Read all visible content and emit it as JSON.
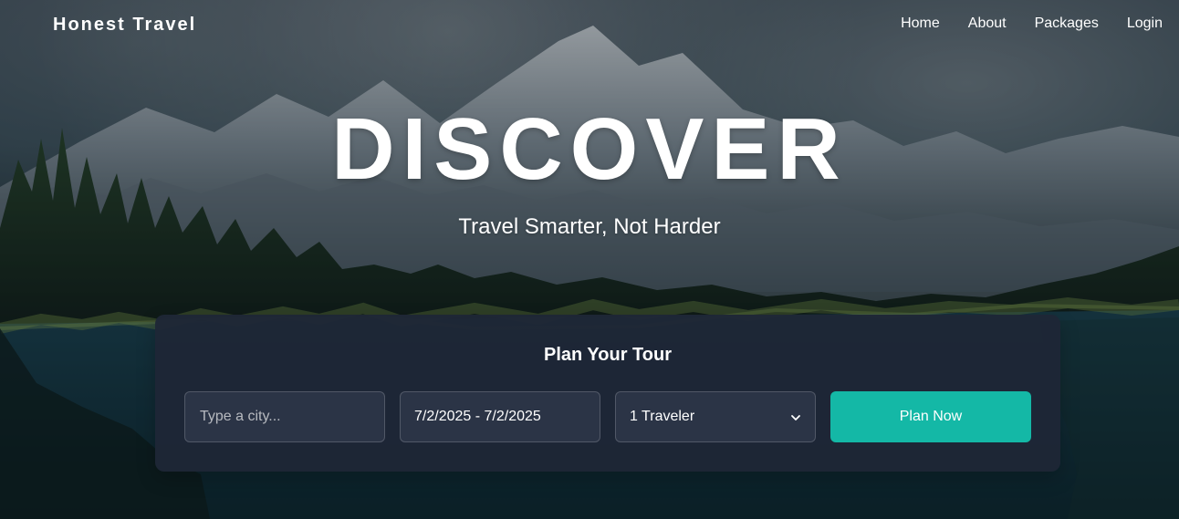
{
  "brand": "Honest Travel",
  "nav": [
    {
      "label": "Home"
    },
    {
      "label": "About"
    },
    {
      "label": "Packages"
    },
    {
      "label": "Login"
    }
  ],
  "hero": {
    "title": "DISCOVER",
    "subtitle": "Travel Smarter, Not Harder"
  },
  "planner": {
    "title": "Plan Your Tour",
    "city_placeholder": "Type a city...",
    "date_value": "7/2/2025 - 7/2/2025",
    "traveler_value": "1 Traveler",
    "button_label": "Plan Now"
  },
  "colors": {
    "accent": "#14b8a6",
    "panel": "#1e2736",
    "field": "#2b3446"
  }
}
